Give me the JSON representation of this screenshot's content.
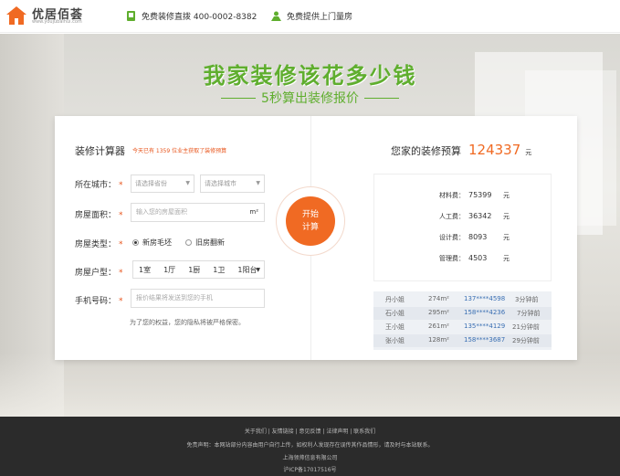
{
  "header": {
    "logo_text": "优居佰荟",
    "logo_sub": "www.youjubaihui.com",
    "hotline": "免费装修直拨 400-0002-8382",
    "service": "免费提供上门量房"
  },
  "hero": {
    "title": "我家装修该花多少钱",
    "subtitle": "5秒算出装修报价"
  },
  "calculator": {
    "title": "装修计算器",
    "tip": "今天已有 1359 位业主获取了装修预算",
    "city_label": "所在城市：",
    "province_placeholder": "请选择省份",
    "city_placeholder": "请选择城市",
    "area_label": "房屋面积：",
    "area_placeholder": "输入您的房屋面积",
    "area_unit": "m²",
    "type_label": "房屋类型：",
    "type_new": "新房毛坯",
    "type_old": "旧房翻新",
    "layout_label": "房屋户型：",
    "layout_options": [
      "1室",
      "1厅",
      "1厨",
      "1卫",
      "1阳台"
    ],
    "phone_label": "手机号码：",
    "phone_placeholder": "报价结果将发送到您的手机",
    "privacy": "为了您的权益，您的隐私将被严格保密。",
    "start_line1": "开始",
    "start_line2": "计算",
    "required_mark": "*"
  },
  "budget": {
    "title": "您家的装修预算",
    "total": "124337",
    "unit": "元",
    "items": [
      {
        "label": "材料费：",
        "value": "75399",
        "unit": "元"
      },
      {
        "label": "人工费：",
        "value": "36342",
        "unit": "元"
      },
      {
        "label": "设计费：",
        "value": "8093",
        "unit": "元"
      },
      {
        "label": "管理费：",
        "value": "4503",
        "unit": "元"
      }
    ]
  },
  "records": [
    {
      "name": "丹小姐",
      "area": "274m²",
      "phone": "137****4598",
      "time": "3分钟前"
    },
    {
      "name": "石小姐",
      "area": "295m²",
      "phone": "158****4236",
      "time": "7分钟前"
    },
    {
      "name": "王小姐",
      "area": "261m²",
      "phone": "135****4129",
      "time": "21分钟前"
    },
    {
      "name": "张小姐",
      "area": "128m²",
      "phone": "158****3687",
      "time": "29分钟前"
    }
  ],
  "footer": {
    "links": "关于我们 | 友情链接 | 意见反馈 | 法律声明 | 联系我们",
    "disclaimer": "免责声明：本网站部分内容由用户自行上传，如权利人发现存在误传其作品情形，请及时与本站联系。",
    "company": "上海领帅信息有限公司",
    "icp": "沪ICP备17017516号"
  },
  "colors": {
    "accent": "#f06a23",
    "green": "#5fae2e",
    "footer_bg": "#2b2b2b"
  }
}
